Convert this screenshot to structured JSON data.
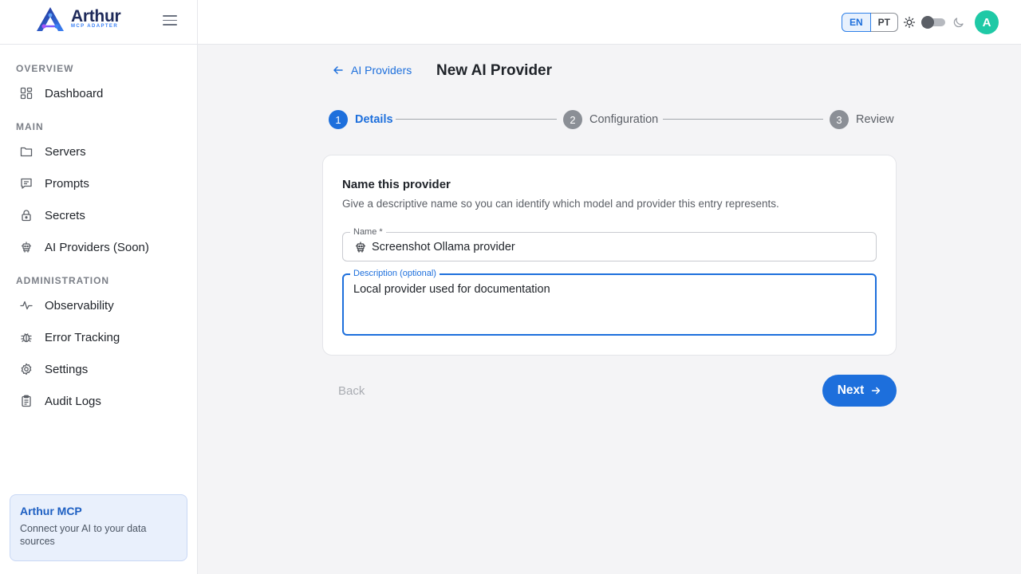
{
  "brand": {
    "name": "Arthur",
    "subtitle": "MCP ADAPTER"
  },
  "sidebar": {
    "sections": [
      {
        "label": "OVERVIEW"
      },
      {
        "label": "MAIN"
      },
      {
        "label": "ADMINISTRATION"
      }
    ],
    "items": [
      {
        "label": "Dashboard",
        "icon": "dashboard-icon"
      },
      {
        "label": "Servers",
        "icon": "folder-icon"
      },
      {
        "label": "Prompts",
        "icon": "message-icon"
      },
      {
        "label": "Secrets",
        "icon": "lock-icon"
      },
      {
        "label": "AI Providers (Soon)",
        "icon": "robot-icon"
      },
      {
        "label": "Observability",
        "icon": "activity-icon"
      },
      {
        "label": "Error Tracking",
        "icon": "bug-icon"
      },
      {
        "label": "Settings",
        "icon": "gear-icon"
      },
      {
        "label": "Audit Logs",
        "icon": "clipboard-icon"
      }
    ],
    "promo": {
      "title": "Arthur MCP",
      "description": "Connect your AI to your data sources"
    }
  },
  "header": {
    "languages": [
      "EN",
      "PT"
    ],
    "active_language": "EN",
    "avatar_initial": "A"
  },
  "main": {
    "back_link": "AI Providers",
    "title": "New AI Provider",
    "steps": [
      {
        "number": "1",
        "label": "Details"
      },
      {
        "number": "2",
        "label": "Configuration"
      },
      {
        "number": "3",
        "label": "Review"
      }
    ],
    "active_step": 1,
    "card": {
      "title": "Name this provider",
      "description": "Give a descriptive name so you can identify which model and provider this entry represents.",
      "name_label": "Name *",
      "name_value": "Screenshot Ollama provider",
      "description_label": "Description (optional)",
      "description_value": "Local provider used for documentation"
    },
    "back_button": "Back",
    "next_button": "Next"
  },
  "colors": {
    "primary": "#1d6fdc",
    "avatar": "#1fc9a6",
    "brand_text": "#1e2a5a"
  }
}
